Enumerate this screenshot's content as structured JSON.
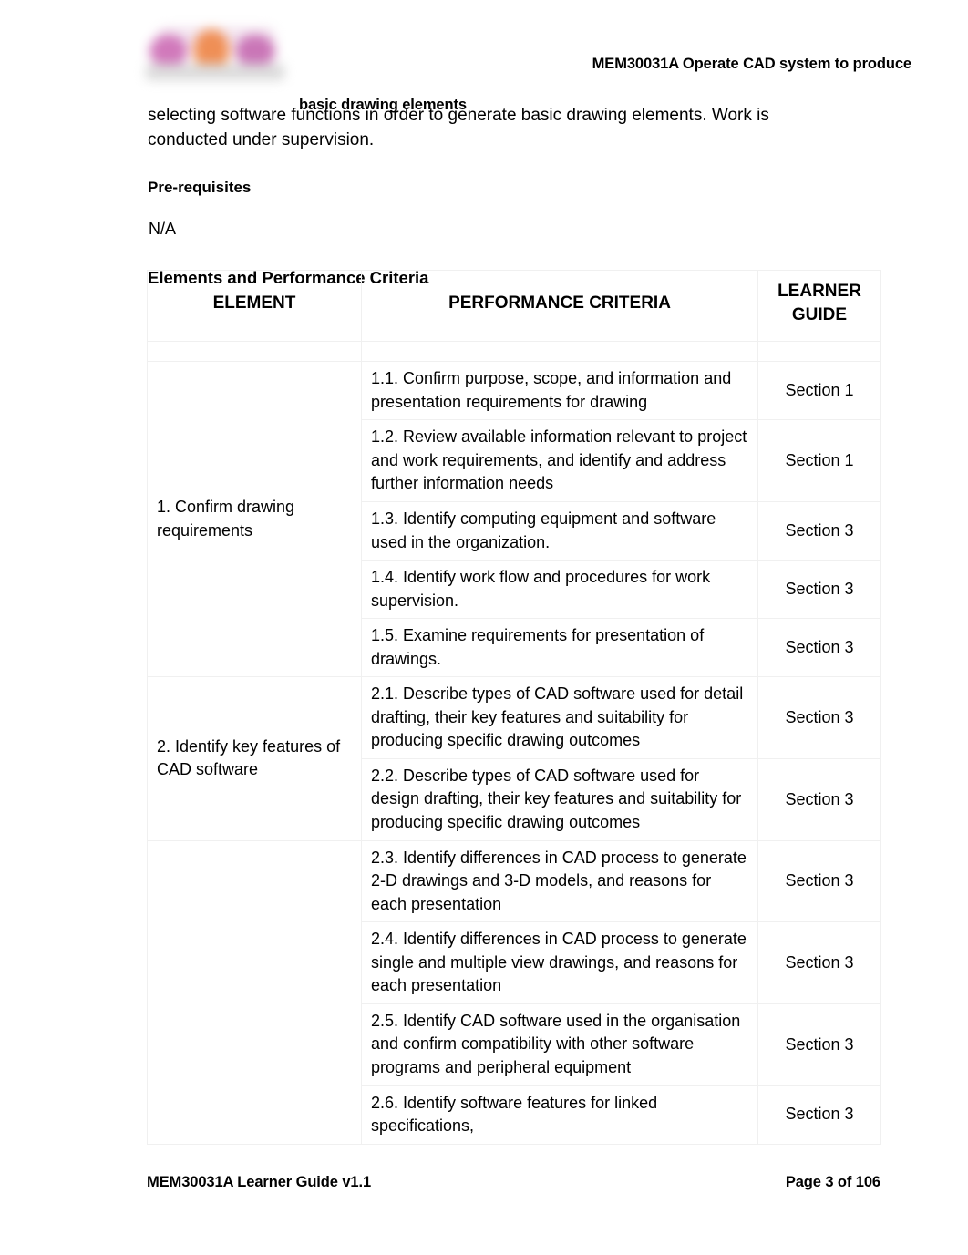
{
  "header": {
    "logo_alt": "training-organisation-logo",
    "title_right": "MEM30031A Operate CAD system to produce",
    "title_left": "basic drawing elements"
  },
  "body": {
    "intro_paragraph": "selecting software functions in order to generate basic drawing elements. Work is conducted under supervision.",
    "prerequisites_heading": "Pre-requisites",
    "prerequisites_value": "N/A",
    "section_heading": "Elements and Performance Criteria"
  },
  "table": {
    "columns": [
      "ELEMENT",
      "PERFORMANCE CRITERIA",
      "LEARNER GUIDE"
    ],
    "column_header_learner_guide_line1": "LEARNER",
    "column_header_learner_guide_line2": "GUIDE",
    "elements": [
      {
        "label": "1. Confirm drawing requirements",
        "criteria": [
          {
            "text": "1.1. Confirm purpose, scope, and information and presentation requirements for drawing",
            "guide": "Section 1"
          },
          {
            "text": "1.2. Review available information relevant to project and work requirements, and identify and address further information needs",
            "guide": "Section 1"
          },
          {
            "text": "1.3. Identify computing equipment and software used in the organization.",
            "guide": "Section 3"
          },
          {
            "text": "1.4. Identify work flow and procedures for work supervision.",
            "guide": "Section 3"
          },
          {
            "text": "1.5. Examine requirements for presentation of drawings.",
            "guide": "Section 3"
          }
        ]
      },
      {
        "label": "2. Identify key features of CAD software",
        "criteria": [
          {
            "text": "2.1. Describe types of CAD software used for detail drafting, their key features and suitability for producing specific drawing outcomes",
            "guide": "Section 3"
          },
          {
            "text": "2.2. Describe types of CAD software used for design drafting, their key features and suitability for producing specific drawing outcomes",
            "guide": "Section 3"
          }
        ]
      },
      {
        "label": "",
        "criteria": [
          {
            "text": "2.3. Identify differences in CAD process to generate 2-D drawings and 3-D models, and reasons for each presentation",
            "guide": "Section 3"
          },
          {
            "text": "2.4. Identify differences in CAD process to generate single and multiple view drawings, and reasons for each presentation",
            "guide": "Section 3"
          },
          {
            "text": "2.5. Identify CAD software used in the organisation and confirm compatibility with other software programs and peripheral equipment",
            "guide": "Section 3"
          },
          {
            "text": "2.6. Identify software features for linked specifications,",
            "guide": "Section 3"
          }
        ]
      }
    ]
  },
  "footer": {
    "left": "MEM30031A Learner Guide v1.1",
    "right": "Page 3 of 106"
  }
}
